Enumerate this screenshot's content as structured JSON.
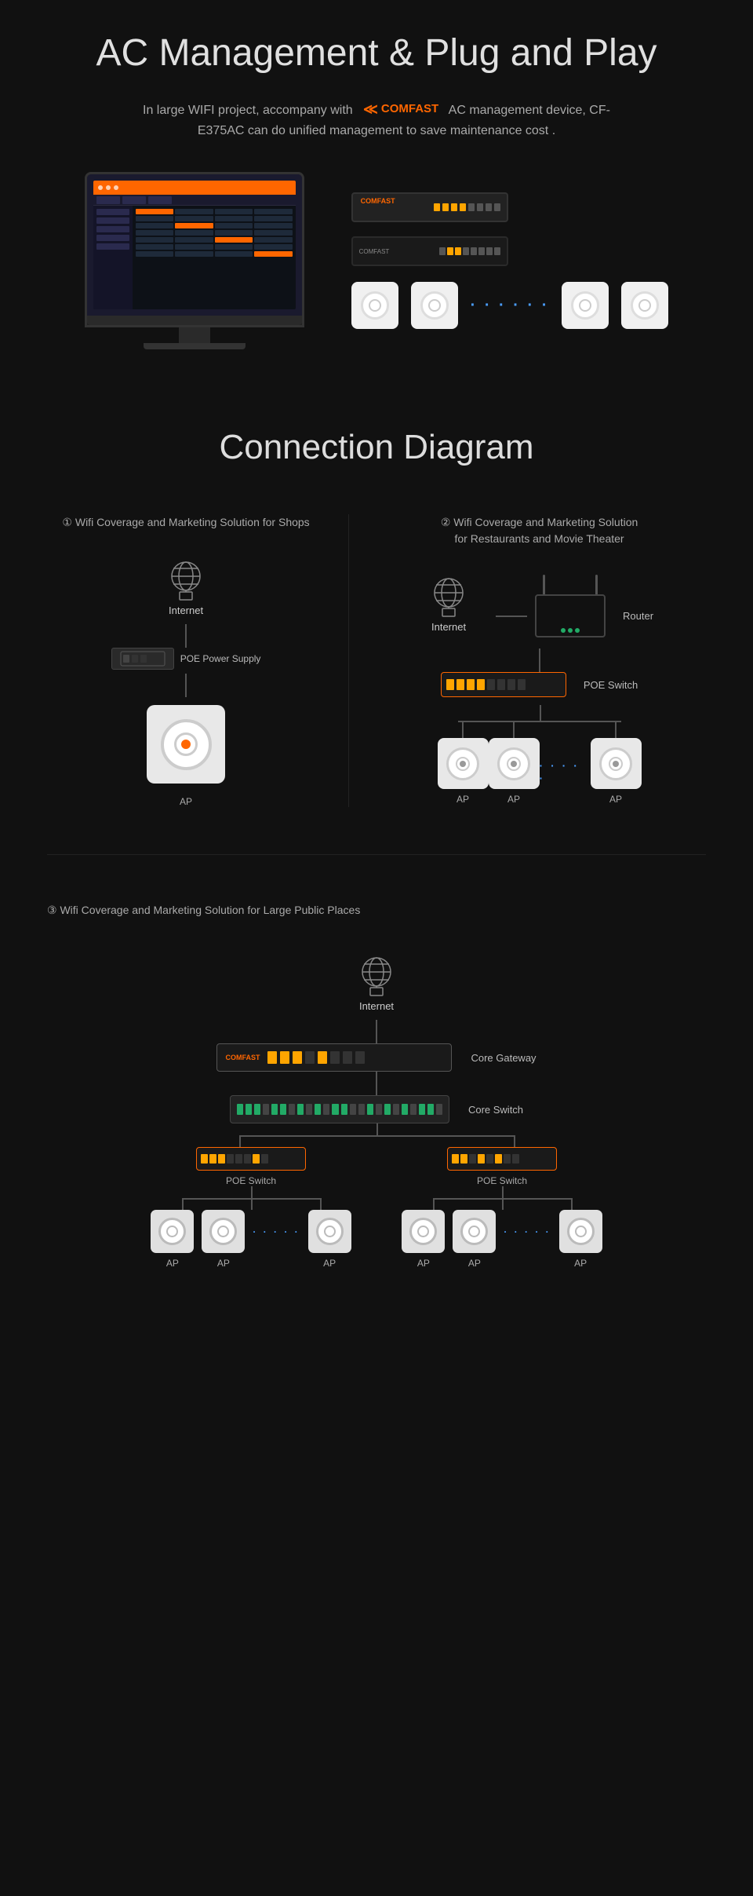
{
  "page": {
    "bg_color": "#111"
  },
  "section_ac": {
    "title": "AC Management & Plug and Play",
    "description_before": "In large WIFI project, accompany with",
    "brand": "COMFAST",
    "description_after": "AC management device, CF-E375AC can do unified management to save maintenance cost .",
    "dots": "· · ·  · · ·"
  },
  "section_diagram": {
    "title": "Connection Diagram",
    "scenario1": {
      "num": "①",
      "title": "Wifi Coverage and Marketing Solution for Shops",
      "internet_label": "Internet",
      "poe_label": "POE Power Supply",
      "ap_label": "AP"
    },
    "scenario2": {
      "num": "②",
      "title": "Wifi Coverage and Marketing Solution\nfor Restaurants and Movie Theater",
      "internet_label": "Internet",
      "router_label": "Router",
      "poe_switch_label": "POE Switch",
      "ap_label": "AP",
      "dots": "· · · · ·"
    },
    "scenario3": {
      "num": "③",
      "title": "Wifi Coverage and Marketing Solution for Large Public Places",
      "internet_label": "Internet",
      "core_gateway_label": "Core Gateway",
      "core_switch_label": "Core Switch",
      "poe_switch_left_label": "POE Switch",
      "poe_switch_right_label": "POE Switch",
      "ap_label": "AP",
      "dots": "· · · · ·"
    }
  }
}
